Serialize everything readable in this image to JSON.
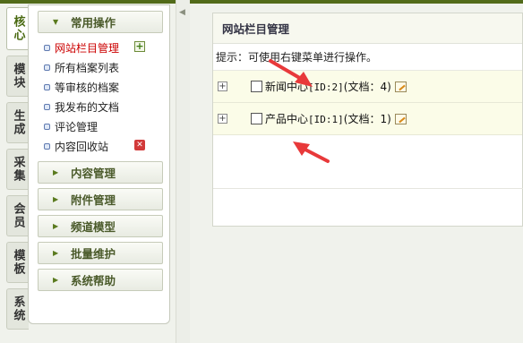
{
  "vertical_tabs": [
    {
      "label": "核心",
      "active": true
    },
    {
      "label": "模块",
      "active": false
    },
    {
      "label": "生成",
      "active": false
    },
    {
      "label": "采集",
      "active": false
    },
    {
      "label": "会员",
      "active": false
    },
    {
      "label": "模板",
      "active": false
    },
    {
      "label": "系统",
      "active": false
    }
  ],
  "menu": {
    "common": {
      "title": "常用操作",
      "items": [
        {
          "label": "网站栏目管理",
          "active": true
        },
        {
          "label": "所有档案列表"
        },
        {
          "label": "等审核的档案"
        },
        {
          "label": "我发布的文档"
        },
        {
          "label": "评论管理"
        },
        {
          "label": "内容回收站"
        }
      ]
    },
    "sections": [
      {
        "title": "内容管理"
      },
      {
        "title": "附件管理"
      },
      {
        "title": "频道模型"
      },
      {
        "title": "批量维护"
      },
      {
        "title": "系统帮助"
      }
    ]
  },
  "icons": {
    "add": "add-icon",
    "recycle": "recycle-bin-icon",
    "expander": "plus-expander-icon",
    "edit": "edit-icon"
  },
  "main": {
    "title": "网站栏目管理",
    "tip": "提示：可使用右键菜单进行操作。",
    "rows": [
      {
        "name": "新闻中心",
        "id_text": "[ID:2]",
        "docs_text": "(文档：4)"
      },
      {
        "name": "产品中心",
        "id_text": "[ID:1]",
        "docs_text": "(文档：1)"
      }
    ]
  },
  "colors": {
    "accent_green": "#526b1a",
    "active_link": "#cc0000",
    "annotation_arrow": "#e8393a"
  }
}
